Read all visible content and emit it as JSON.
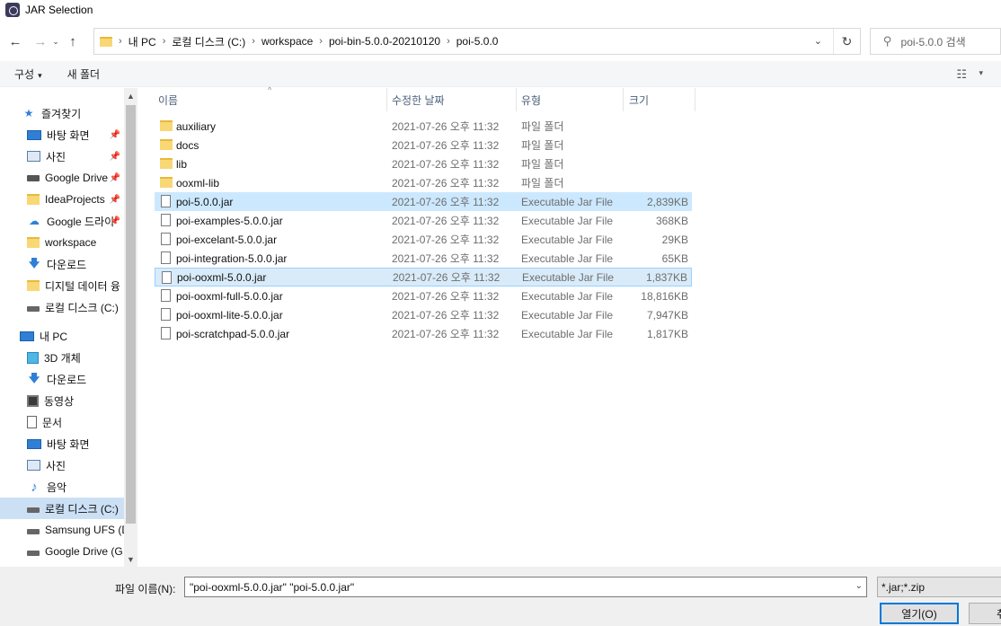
{
  "window": {
    "title": "JAR Selection"
  },
  "address": {
    "crumbs": [
      "내 PC",
      "로컬 디스크 (C:)",
      "workspace",
      "poi-bin-5.0.0-20210120",
      "poi-5.0.0"
    ]
  },
  "search": {
    "placeholder": "poi-5.0.0 검색"
  },
  "toolbar": {
    "organize": "구성",
    "new_folder": "새 폴더"
  },
  "sidebar": {
    "items": [
      {
        "label": "즐겨찾기",
        "icon": "star-icon"
      },
      {
        "label": "바탕 화면",
        "icon": "desktop-icon",
        "pinned": true
      },
      {
        "label": "사진",
        "icon": "pictures-icon",
        "pinned": true
      },
      {
        "label": "Google Drive",
        "icon": "drive-icon",
        "pinned": true
      },
      {
        "label": "IdeaProjects",
        "icon": "folder-icon",
        "pinned": true
      },
      {
        "label": "Google 드라이",
        "icon": "cloud-icon",
        "pinned": true
      },
      {
        "label": "workspace",
        "icon": "folder-icon"
      },
      {
        "label": "다운로드",
        "icon": "download-icon"
      },
      {
        "label": "디지털 데이터 융",
        "icon": "folder-icon"
      },
      {
        "label": "로컬 디스크 (C:)",
        "icon": "drive-icon"
      },
      {
        "label": "내 PC",
        "icon": "pc-icon"
      },
      {
        "label": "3D 개체",
        "icon": "3d-objects-icon"
      },
      {
        "label": "다운로드",
        "icon": "download-icon"
      },
      {
        "label": "동영상",
        "icon": "video-icon"
      },
      {
        "label": "문서",
        "icon": "document-icon"
      },
      {
        "label": "바탕 화면",
        "icon": "desktop-icon"
      },
      {
        "label": "사진",
        "icon": "pictures-icon"
      },
      {
        "label": "음악",
        "icon": "music-icon"
      },
      {
        "label": "로컬 디스크 (C:)",
        "icon": "drive-icon",
        "selected": true
      },
      {
        "label": "Samsung UFS (D",
        "icon": "drive-icon"
      },
      {
        "label": "Google Drive (G",
        "icon": "drive-icon"
      }
    ]
  },
  "columns": {
    "name": "이름",
    "date": "수정한 날짜",
    "type": "유형",
    "size": "크기"
  },
  "files": [
    {
      "name": "auxiliary",
      "date": "2021-07-26 오후 11:32",
      "type": "파일 폴더",
      "size": "",
      "kind": "folder"
    },
    {
      "name": "docs",
      "date": "2021-07-26 오후 11:32",
      "type": "파일 폴더",
      "size": "",
      "kind": "folder"
    },
    {
      "name": "lib",
      "date": "2021-07-26 오후 11:32",
      "type": "파일 폴더",
      "size": "",
      "kind": "folder"
    },
    {
      "name": "ooxml-lib",
      "date": "2021-07-26 오후 11:32",
      "type": "파일 폴더",
      "size": "",
      "kind": "folder"
    },
    {
      "name": "poi-5.0.0.jar",
      "date": "2021-07-26 오후 11:32",
      "type": "Executable Jar File",
      "size": "2,839KB",
      "kind": "file",
      "selected": true
    },
    {
      "name": "poi-examples-5.0.0.jar",
      "date": "2021-07-26 오후 11:32",
      "type": "Executable Jar File",
      "size": "368KB",
      "kind": "file"
    },
    {
      "name": "poi-excelant-5.0.0.jar",
      "date": "2021-07-26 오후 11:32",
      "type": "Executable Jar File",
      "size": "29KB",
      "kind": "file"
    },
    {
      "name": "poi-integration-5.0.0.jar",
      "date": "2021-07-26 오후 11:32",
      "type": "Executable Jar File",
      "size": "65KB",
      "kind": "file"
    },
    {
      "name": "poi-ooxml-5.0.0.jar",
      "date": "2021-07-26 오후 11:32",
      "type": "Executable Jar File",
      "size": "1,837KB",
      "kind": "file",
      "selected": true,
      "focused": true
    },
    {
      "name": "poi-ooxml-full-5.0.0.jar",
      "date": "2021-07-26 오후 11:32",
      "type": "Executable Jar File",
      "size": "18,816KB",
      "kind": "file"
    },
    {
      "name": "poi-ooxml-lite-5.0.0.jar",
      "date": "2021-07-26 오후 11:32",
      "type": "Executable Jar File",
      "size": "7,947KB",
      "kind": "file"
    },
    {
      "name": "poi-scratchpad-5.0.0.jar",
      "date": "2021-07-26 오후 11:32",
      "type": "Executable Jar File",
      "size": "1,817KB",
      "kind": "file"
    }
  ],
  "bottom": {
    "filename_label": "파일 이름(N):",
    "filename_value": "\"poi-ooxml-5.0.0.jar\" \"poi-5.0.0.jar\"",
    "filter": "*.jar;*.zip",
    "open_label": "열기(O)",
    "cancel_label": "취소"
  },
  "colors": {
    "selection": "#cce8ff",
    "accent": "#0078d7",
    "folder": "#f8d775"
  }
}
